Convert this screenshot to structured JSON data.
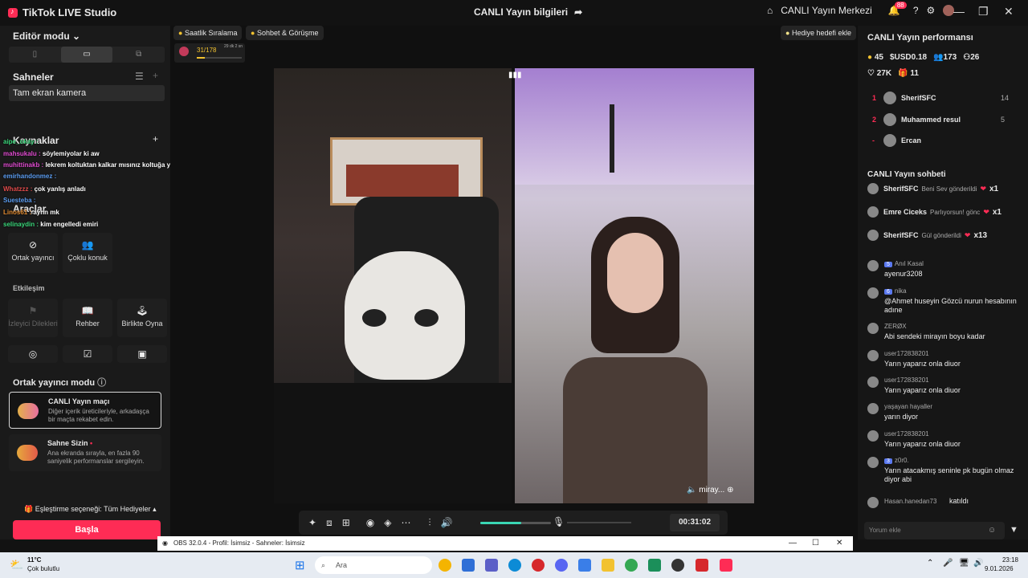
{
  "titlebar": {
    "app_name": "TikTok LIVE Studio",
    "center_title": "CANLI Yayın bilgileri",
    "center_button": "CANLI Yayın Merkezi",
    "notif_count": "88"
  },
  "left": {
    "editor_mode": "Editör modu",
    "scenes_title": "Sahneler",
    "scene_item": "Tam ekran kamera",
    "sources_title": "Kaynaklar",
    "tools_title": "Araçlar",
    "overlay_chat": [
      {
        "user": "aipe_okay :",
        "text": "",
        "color": "#3ad67a"
      },
      {
        "user": "mahsukalu :",
        "text": "söylemiyolar ki aw",
        "color": "#e04bd0"
      },
      {
        "user": "muhittinakb :",
        "text": "lekrem koltuktan kalkar mısınız koltuğa yükseldim ben adım emre",
        "color": "#e04bd0"
      },
      {
        "user": "emirhandonmez :",
        "text": "",
        "color": "#5b9cf0"
      },
      {
        "user": "Whatzzz :",
        "text": "çok yanlış anladı",
        "color": "#e04b4b"
      },
      {
        "user": "Suesteba :",
        "text": "",
        "color": "#5b9cf0"
      },
      {
        "user": "Linos61 :",
        "text": "aynn mk",
        "color": "#e08a30"
      },
      {
        "user": "selinaydin :",
        "text": "kim engelledi emiri",
        "color": "#3ad67a"
      }
    ],
    "tools": [
      {
        "label": "Ortak yayıncı"
      },
      {
        "label": "Çoklu konuk"
      }
    ],
    "interaction_title": "Etkileşim",
    "interactions": [
      {
        "label": "İzleyici Dilekleri"
      },
      {
        "label": "Rehber"
      },
      {
        "label": "Birlikte Oyna"
      }
    ],
    "cohost_mode_title": "Ortak yayıncı modu",
    "modes": [
      {
        "title": "CANLI Yayın maçı",
        "desc": "Diğer içerik üreticileriyle, arkadaşça bir maçta rekabet edin."
      },
      {
        "title": "Sahne Sizin",
        "desc": "Ana ekranda sırayla, en fazla 90 saniyelik performanslar sergileyin."
      }
    ],
    "match_option": "Eşleştirme seçeneği: Tüm Hediyeler",
    "start_button": "Başla"
  },
  "center": {
    "chip_hourly": "Saatlik Sıralama",
    "chip_chat": "Sohbet & Görüşme",
    "gift_goal_button": "Hediye hedefi ekle",
    "goal_progress_text": "31/178",
    "goal_timer": "29 dk 2 sn",
    "goal_progress": 0.17,
    "right_video_label": "miray...",
    "volume_level": 0.58,
    "timer": "00:31:02"
  },
  "right": {
    "perf_title": "CANLI Yayın performansı",
    "stats": {
      "coins": "45",
      "usd": "USD0.18",
      "viewers": "173",
      "followers": "26",
      "likes": "27K",
      "gifts": "11"
    },
    "ranking": [
      {
        "rank": "1",
        "name": "SherifSFC",
        "value": "14"
      },
      {
        "rank": "2",
        "name": "Muhammed resul",
        "value": "5"
      },
      {
        "rank": "-",
        "name": "Ercan",
        "value": ""
      }
    ],
    "chat_title": "CANLI Yayın sohbeti",
    "gift_events": [
      {
        "name": "SherifSFC",
        "text": "Beni Sev gönderildi",
        "count": "x1"
      },
      {
        "name": "Emre Ciceks",
        "text": "Parlıyorsun! gönc",
        "count": "x1"
      },
      {
        "name": "SherifSFC",
        "text": "Gül gönderildi",
        "count": "x13"
      }
    ],
    "messages": [
      {
        "level": "5",
        "name": "Anıl Kasal",
        "msg": "ayenur3208"
      },
      {
        "level": "6",
        "name": "nika",
        "msg": "@Ahmet huseyin Gözcü nurun hesabının adıne"
      },
      {
        "level": "",
        "name": "ZERØX",
        "msg": "Abi sendeki mirayın boyu kadar"
      },
      {
        "level": "",
        "name": "user172838201",
        "msg": "Yarın yaparız onla diuor"
      },
      {
        "level": "",
        "name": "user172838201",
        "msg": "Yarın yaparız onla diuor"
      },
      {
        "level": "",
        "name": "yaşayan hayaller",
        "msg": "yarın diyor"
      },
      {
        "level": "",
        "name": "user172838201",
        "msg": "Yarın yaparız onla diuor"
      },
      {
        "level": "3",
        "name": "z0r0.",
        "msg": "Yarın atacakmış seninle pk bugün olmaz diyor abi"
      },
      {
        "level": "",
        "name": "Hasan.hanedan73",
        "msg": "katıldı"
      }
    ],
    "comment_placeholder": "Yorum ekle"
  },
  "obs": {
    "title": "OBS 32.0.4 - Profil: İsimsiz - Sahneler: İsimsiz"
  },
  "taskbar": {
    "weather_temp": "11°C",
    "weather_desc": "Çok bulutlu",
    "search_placeholder": "Ara",
    "time": "23:18",
    "date": "9.01.2026"
  }
}
